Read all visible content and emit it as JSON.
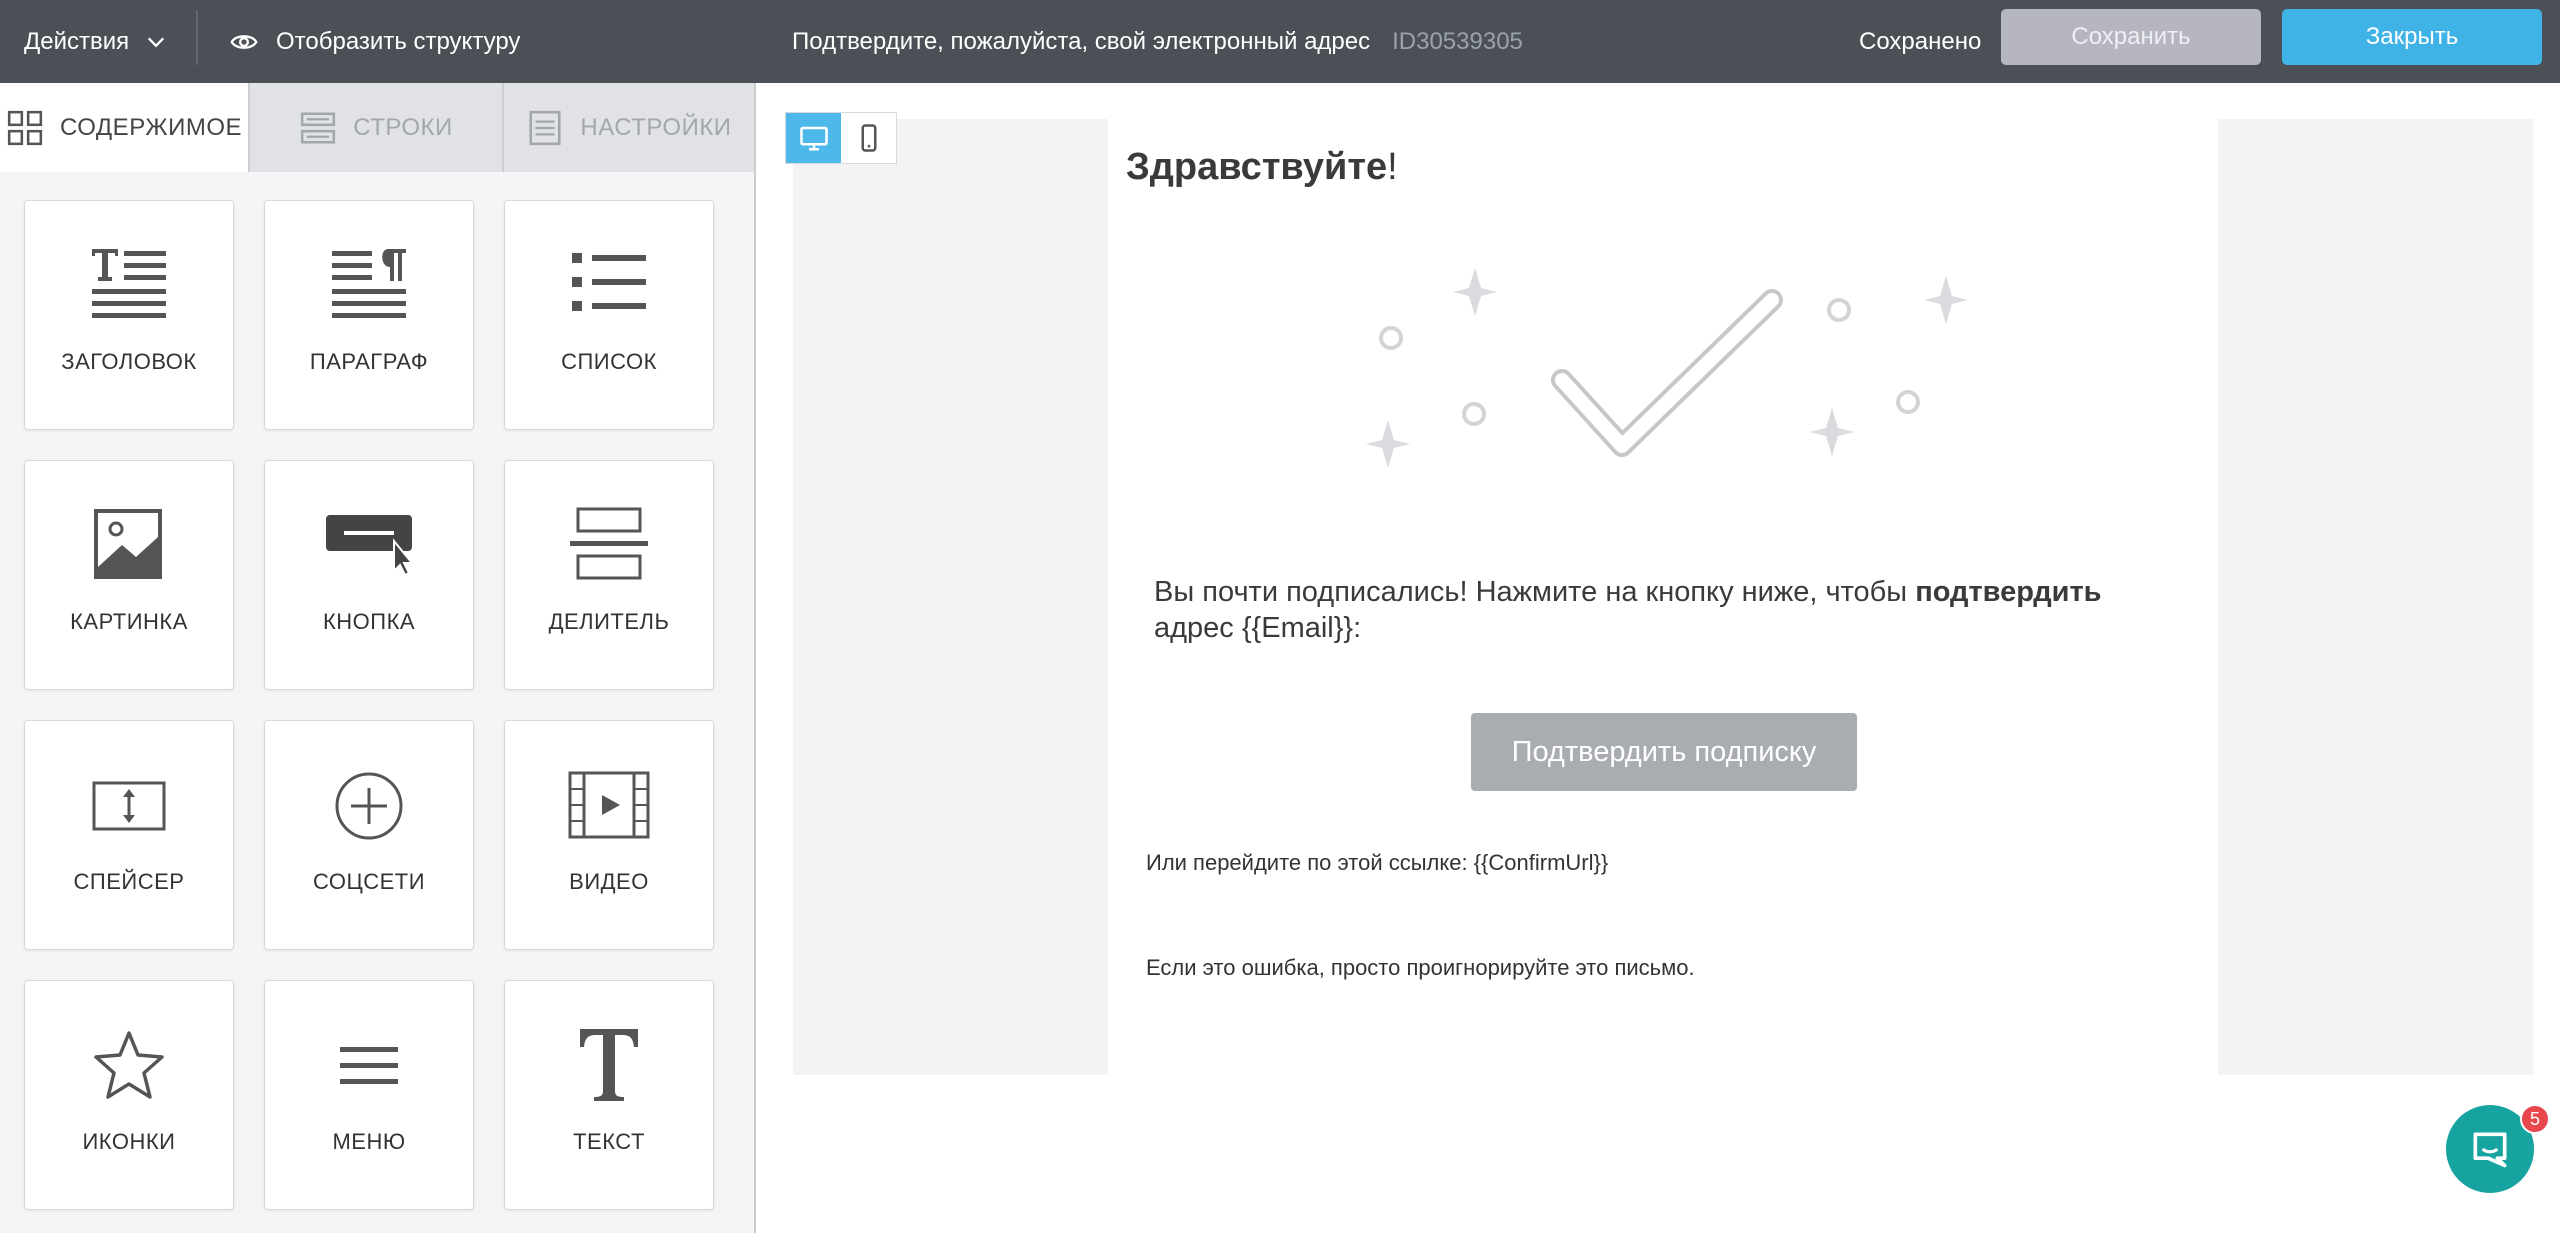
{
  "topbar": {
    "actions_label": "Действия",
    "show_structure_label": "Отобразить структуру",
    "document_title": "Подтвердите, пожалуйста, свой электронный адрес",
    "document_id": "ID30539305",
    "saved_status": "Сохранено",
    "save_label": "Сохранить",
    "close_label": "Закрыть"
  },
  "sidebar": {
    "tabs": [
      {
        "label": "СОДЕРЖИМОЕ",
        "icon": "grid-icon",
        "active": true
      },
      {
        "label": "СТРОКИ",
        "icon": "rows-icon",
        "active": false
      },
      {
        "label": "НАСТРОЙКИ",
        "icon": "settings-list-icon",
        "active": false
      }
    ],
    "blocks": [
      {
        "label": "ЗАГОЛОВОК",
        "icon": "heading-icon"
      },
      {
        "label": "ПАРАГРАФ",
        "icon": "paragraph-icon"
      },
      {
        "label": "СПИСОК",
        "icon": "list-icon"
      },
      {
        "label": "КАРТИНКА",
        "icon": "image-icon"
      },
      {
        "label": "КНОПКА",
        "icon": "button-icon"
      },
      {
        "label": "ДЕЛИТЕЛЬ",
        "icon": "divider-icon"
      },
      {
        "label": "СПЕЙСЕР",
        "icon": "spacer-icon"
      },
      {
        "label": "СОЦСЕТИ",
        "icon": "social-icon"
      },
      {
        "label": "ВИДЕО",
        "icon": "video-icon"
      },
      {
        "label": "ИКОНКИ",
        "icon": "star-icon"
      },
      {
        "label": "МЕНЮ",
        "icon": "menu-icon"
      },
      {
        "label": "ТЕКСТ",
        "icon": "text-icon"
      }
    ]
  },
  "canvas": {
    "device_modes": [
      "desktop-icon",
      "mobile-icon"
    ],
    "active_device": "desktop",
    "email": {
      "greeting": "Здравствуйте",
      "greeting_punct": "!",
      "lead_text_1": "Вы почти подписались! Нажмите на кнопку ниже, чтобы ",
      "lead_text_bold": "подтвердить",
      "lead_text_2": " адрес {{Email}}:",
      "confirm_button": "Подтвердить подписку",
      "link_line": "Или перейдите по этой ссылке: {{ConfirmUrl}}",
      "ignore_line": "Если это ошибка, просто проигнорируйте это письмо."
    }
  },
  "chat_widget": {
    "unread_count": "5"
  },
  "colors": {
    "topbar_bg": "#4a5055",
    "save_button": "#b5b6bf",
    "close_button": "#3fb2e6",
    "accent": "#4db8ea",
    "chat": "#17a3a0",
    "badge": "#e8474d"
  }
}
